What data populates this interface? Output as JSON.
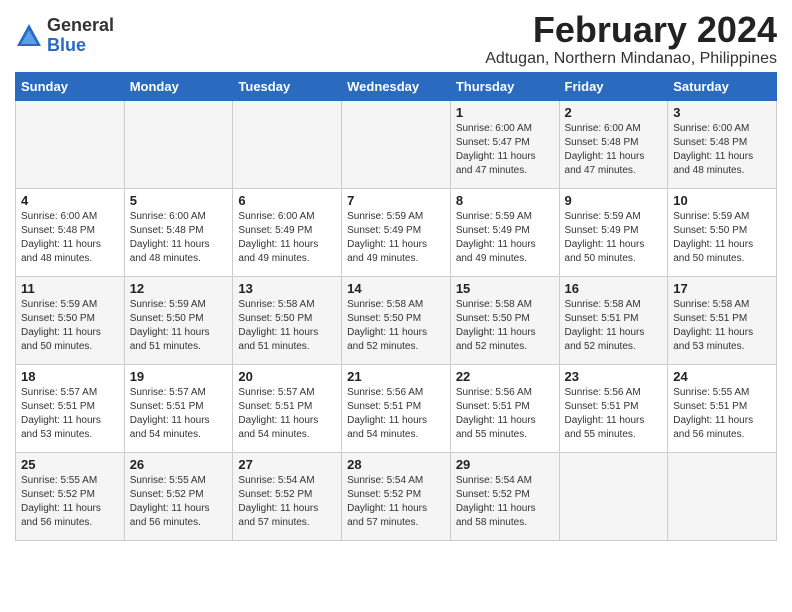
{
  "logo": {
    "general": "General",
    "blue": "Blue"
  },
  "title": "February 2024",
  "location": "Adtugan, Northern Mindanao, Philippines",
  "days_of_week": [
    "Sunday",
    "Monday",
    "Tuesday",
    "Wednesday",
    "Thursday",
    "Friday",
    "Saturday"
  ],
  "weeks": [
    [
      {
        "day": "",
        "info": ""
      },
      {
        "day": "",
        "info": ""
      },
      {
        "day": "",
        "info": ""
      },
      {
        "day": "",
        "info": ""
      },
      {
        "day": "1",
        "info": "Sunrise: 6:00 AM\nSunset: 5:47 PM\nDaylight: 11 hours\nand 47 minutes."
      },
      {
        "day": "2",
        "info": "Sunrise: 6:00 AM\nSunset: 5:48 PM\nDaylight: 11 hours\nand 47 minutes."
      },
      {
        "day": "3",
        "info": "Sunrise: 6:00 AM\nSunset: 5:48 PM\nDaylight: 11 hours\nand 48 minutes."
      }
    ],
    [
      {
        "day": "4",
        "info": "Sunrise: 6:00 AM\nSunset: 5:48 PM\nDaylight: 11 hours\nand 48 minutes."
      },
      {
        "day": "5",
        "info": "Sunrise: 6:00 AM\nSunset: 5:48 PM\nDaylight: 11 hours\nand 48 minutes."
      },
      {
        "day": "6",
        "info": "Sunrise: 6:00 AM\nSunset: 5:49 PM\nDaylight: 11 hours\nand 49 minutes."
      },
      {
        "day": "7",
        "info": "Sunrise: 5:59 AM\nSunset: 5:49 PM\nDaylight: 11 hours\nand 49 minutes."
      },
      {
        "day": "8",
        "info": "Sunrise: 5:59 AM\nSunset: 5:49 PM\nDaylight: 11 hours\nand 49 minutes."
      },
      {
        "day": "9",
        "info": "Sunrise: 5:59 AM\nSunset: 5:49 PM\nDaylight: 11 hours\nand 50 minutes."
      },
      {
        "day": "10",
        "info": "Sunrise: 5:59 AM\nSunset: 5:50 PM\nDaylight: 11 hours\nand 50 minutes."
      }
    ],
    [
      {
        "day": "11",
        "info": "Sunrise: 5:59 AM\nSunset: 5:50 PM\nDaylight: 11 hours\nand 50 minutes."
      },
      {
        "day": "12",
        "info": "Sunrise: 5:59 AM\nSunset: 5:50 PM\nDaylight: 11 hours\nand 51 minutes."
      },
      {
        "day": "13",
        "info": "Sunrise: 5:58 AM\nSunset: 5:50 PM\nDaylight: 11 hours\nand 51 minutes."
      },
      {
        "day": "14",
        "info": "Sunrise: 5:58 AM\nSunset: 5:50 PM\nDaylight: 11 hours\nand 52 minutes."
      },
      {
        "day": "15",
        "info": "Sunrise: 5:58 AM\nSunset: 5:50 PM\nDaylight: 11 hours\nand 52 minutes."
      },
      {
        "day": "16",
        "info": "Sunrise: 5:58 AM\nSunset: 5:51 PM\nDaylight: 11 hours\nand 52 minutes."
      },
      {
        "day": "17",
        "info": "Sunrise: 5:58 AM\nSunset: 5:51 PM\nDaylight: 11 hours\nand 53 minutes."
      }
    ],
    [
      {
        "day": "18",
        "info": "Sunrise: 5:57 AM\nSunset: 5:51 PM\nDaylight: 11 hours\nand 53 minutes."
      },
      {
        "day": "19",
        "info": "Sunrise: 5:57 AM\nSunset: 5:51 PM\nDaylight: 11 hours\nand 54 minutes."
      },
      {
        "day": "20",
        "info": "Sunrise: 5:57 AM\nSunset: 5:51 PM\nDaylight: 11 hours\nand 54 minutes."
      },
      {
        "day": "21",
        "info": "Sunrise: 5:56 AM\nSunset: 5:51 PM\nDaylight: 11 hours\nand 54 minutes."
      },
      {
        "day": "22",
        "info": "Sunrise: 5:56 AM\nSunset: 5:51 PM\nDaylight: 11 hours\nand 55 minutes."
      },
      {
        "day": "23",
        "info": "Sunrise: 5:56 AM\nSunset: 5:51 PM\nDaylight: 11 hours\nand 55 minutes."
      },
      {
        "day": "24",
        "info": "Sunrise: 5:55 AM\nSunset: 5:51 PM\nDaylight: 11 hours\nand 56 minutes."
      }
    ],
    [
      {
        "day": "25",
        "info": "Sunrise: 5:55 AM\nSunset: 5:52 PM\nDaylight: 11 hours\nand 56 minutes."
      },
      {
        "day": "26",
        "info": "Sunrise: 5:55 AM\nSunset: 5:52 PM\nDaylight: 11 hours\nand 56 minutes."
      },
      {
        "day": "27",
        "info": "Sunrise: 5:54 AM\nSunset: 5:52 PM\nDaylight: 11 hours\nand 57 minutes."
      },
      {
        "day": "28",
        "info": "Sunrise: 5:54 AM\nSunset: 5:52 PM\nDaylight: 11 hours\nand 57 minutes."
      },
      {
        "day": "29",
        "info": "Sunrise: 5:54 AM\nSunset: 5:52 PM\nDaylight: 11 hours\nand 58 minutes."
      },
      {
        "day": "",
        "info": ""
      },
      {
        "day": "",
        "info": ""
      }
    ]
  ]
}
